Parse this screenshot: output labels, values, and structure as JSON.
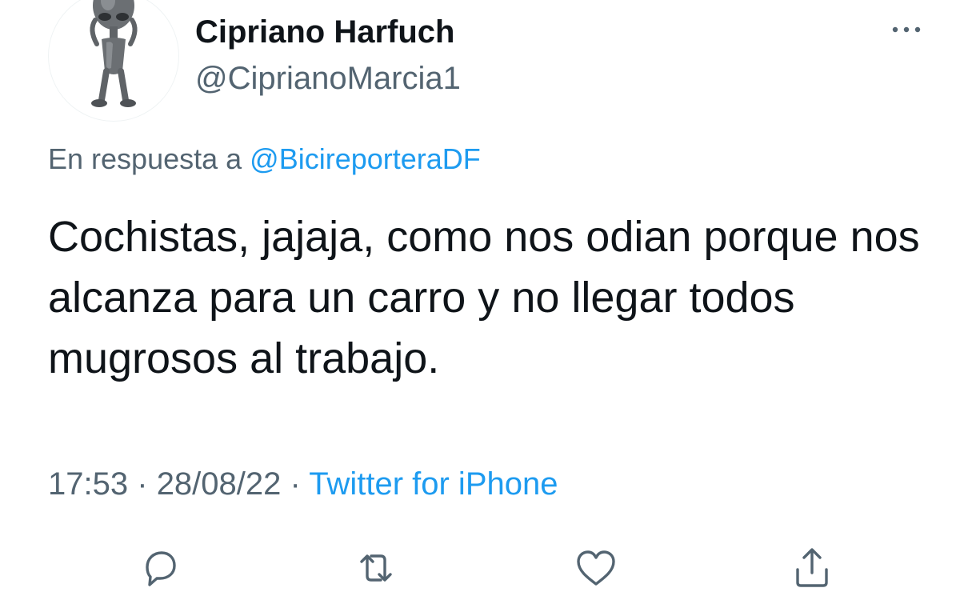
{
  "user": {
    "display_name": "Cipriano Harfuch",
    "handle": "@CiprianoMarcia1",
    "avatar_icon": "alien-figurine-avatar"
  },
  "menu": {
    "icon": "more-dots-icon"
  },
  "reply": {
    "prefix": "En respuesta a",
    "mention": "@BicireporteraDF"
  },
  "tweet": {
    "text": "Cochistas, jajaja, como nos odian porque nos alcanza para un carro y no llegar todos mugrosos al trabajo.",
    "time": "17:53",
    "separator": "·",
    "date": "28/08/22",
    "source": "Twitter for iPhone"
  },
  "actions": [
    {
      "icon": "reply-icon"
    },
    {
      "icon": "retweet-icon"
    },
    {
      "icon": "like-heart-icon"
    },
    {
      "icon": "share-icon"
    }
  ],
  "colors": {
    "text": "#0f1419",
    "secondary": "#536471",
    "link": "#1d9bf0"
  }
}
